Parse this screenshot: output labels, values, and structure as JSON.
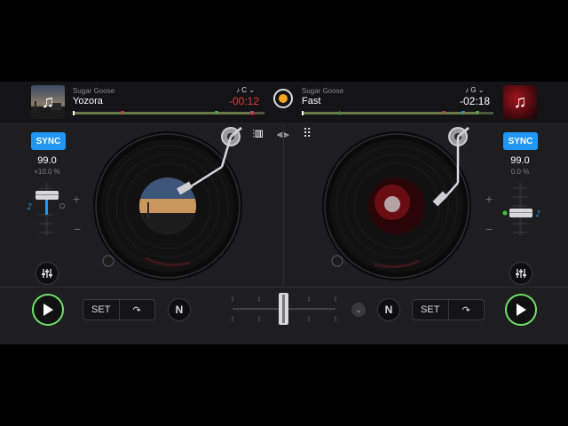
{
  "colors": {
    "accent": "#2196f3",
    "play": "#6ee36a",
    "remaining_red": "#e53935",
    "center_dot": "#f5a623"
  },
  "deck_left": {
    "artist": "Sugar Goose",
    "title": "Yozora",
    "key": "C",
    "time": "-00:12",
    "sync_label": "SYNC",
    "bpm": "99.0",
    "pitch": "+10.0 %",
    "set_label": "SET",
    "icons": [
      "music-note-icon",
      "play-icon",
      "loop-icon",
      "n-icon",
      "equalizer-icon"
    ]
  },
  "deck_right": {
    "artist": "Sugar Goose",
    "title": "Fast",
    "key": "G",
    "time": "-02:18",
    "sync_label": "SYNC",
    "bpm": "99.0",
    "pitch": "0.0 %",
    "set_label": "SET",
    "icons": [
      "music-note-icon",
      "play-icon",
      "loop-icon",
      "n-icon",
      "equalizer-icon"
    ]
  },
  "center": {
    "icons": [
      "mixer-icon",
      "waveform-icon",
      "grid-icon",
      "chevron-down-icon"
    ],
    "crossfader_position": 0.5
  }
}
